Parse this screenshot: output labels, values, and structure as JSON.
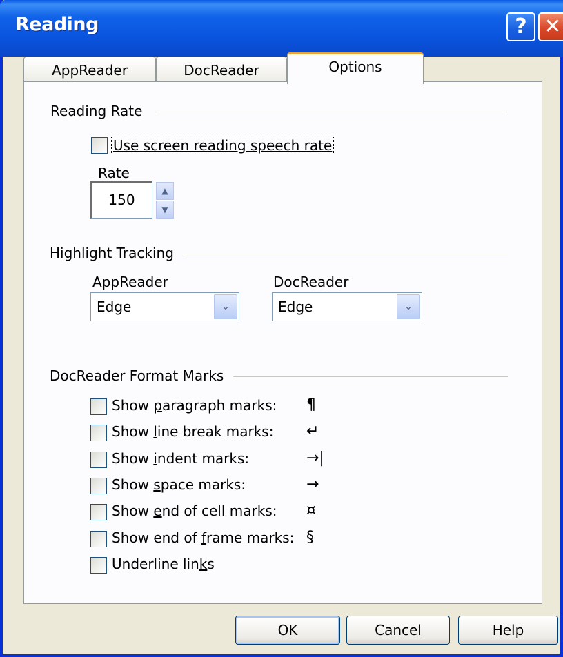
{
  "window": {
    "title": "Reading"
  },
  "titlebar": {
    "help_label": "?",
    "close_label": "✕"
  },
  "tabs": [
    {
      "label": "AppReader"
    },
    {
      "label": "DocReader"
    },
    {
      "label": "Options"
    }
  ],
  "reading_rate": {
    "group_label": "Reading Rate",
    "use_screen_rate": {
      "label": "Use screen reading speech rate",
      "checked": false
    },
    "rate_label": "Rate",
    "rate_value": "150",
    "spin_up": "▲",
    "spin_down": "▼"
  },
  "highlight_tracking": {
    "group_label": "Highlight Tracking",
    "appreader": {
      "label": "AppReader",
      "selected": "Edge"
    },
    "docreader": {
      "label": "DocReader",
      "selected": "Edge"
    },
    "dropdown_arrow": "⌄"
  },
  "format_marks": {
    "group_label": "DocReader Format Marks",
    "items": [
      {
        "pre": "Show ",
        "key": "p",
        "post": "aragraph marks:",
        "mark": "¶",
        "checked": false
      },
      {
        "pre": "Show ",
        "key": "l",
        "post": "ine break marks:",
        "mark": "↵",
        "checked": false
      },
      {
        "pre": "Show ",
        "key": "i",
        "post": "ndent marks:",
        "mark": "→|",
        "checked": false
      },
      {
        "pre": "Show ",
        "key": "s",
        "post": "pace marks:",
        "mark": "→",
        "checked": false
      },
      {
        "pre": "Show ",
        "key": "e",
        "post": "nd of cell marks:",
        "mark": "¤",
        "checked": false
      },
      {
        "pre": "Show end of ",
        "key": "f",
        "post": "rame marks:",
        "mark": "§",
        "checked": false
      },
      {
        "pre": "Underline lin",
        "key": "k",
        "post": "s",
        "mark": "",
        "checked": false
      }
    ]
  },
  "buttons": {
    "ok": "OK",
    "cancel": "Cancel",
    "help": "Help"
  }
}
